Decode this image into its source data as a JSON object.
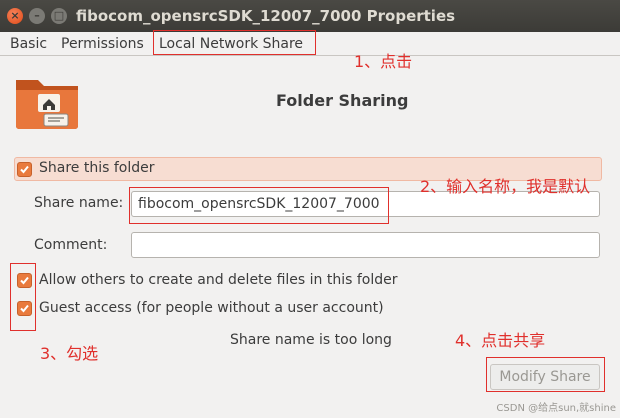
{
  "window": {
    "title": "fibocom_opensrcSDK_12007_7000 Properties",
    "close_glyph": "×",
    "min_glyph": "–",
    "max_glyph": "□"
  },
  "tabs": [
    {
      "label": "Basic"
    },
    {
      "label": "Permissions"
    },
    {
      "label": "Local Network Share"
    }
  ],
  "annotations": {
    "step1": "1、点击",
    "step2": "2、输入名称，我是默认",
    "step3": "3、勾选",
    "step4": "4、点击共享"
  },
  "header": {
    "icon": "folder-share-icon",
    "title": "Folder Sharing"
  },
  "form": {
    "share_folder_label": "Share this folder",
    "share_folder_checked": true,
    "share_name_label": "Share name:",
    "share_name_value": "fibocom_opensrcSDK_12007_7000",
    "comment_label": "Comment:",
    "comment_value": "",
    "allow_others_label": "Allow others to create and delete files in this folder",
    "allow_others_checked": true,
    "guest_access_label": "Guest access (for people without a user account)",
    "guest_access_checked": true
  },
  "status_text": "Share name is too long",
  "modify_button_label": "Modify Share",
  "watermark": "CSDN @给点sun,就shine",
  "colors": {
    "accent": "#e97a3d",
    "annotation": "#e0302c",
    "titlebar": "#3c3b37"
  }
}
